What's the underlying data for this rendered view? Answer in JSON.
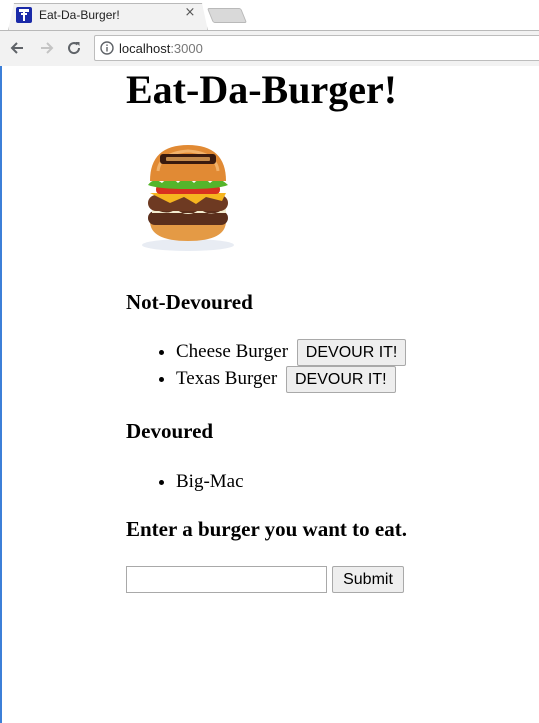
{
  "browser": {
    "tab_title": "Eat-Da-Burger!",
    "tab_close": "×",
    "url_host": "localhost",
    "url_port": ":3000",
    "accent": "#1a2aa8"
  },
  "page": {
    "title": "Eat-Da-Burger!",
    "burger_image_alt": "burger",
    "not_devoured_heading": "Not-Devoured",
    "not_devoured": [
      {
        "name": "Cheese Burger",
        "button": "DEVOUR IT!"
      },
      {
        "name": "Texas Burger",
        "button": "DEVOUR IT!"
      }
    ],
    "devoured_heading": "Devoured",
    "devoured": [
      {
        "name": "Big-Mac"
      }
    ],
    "form_heading": "Enter a burger you want to eat.",
    "input_value": "",
    "submit_label": "Submit"
  }
}
